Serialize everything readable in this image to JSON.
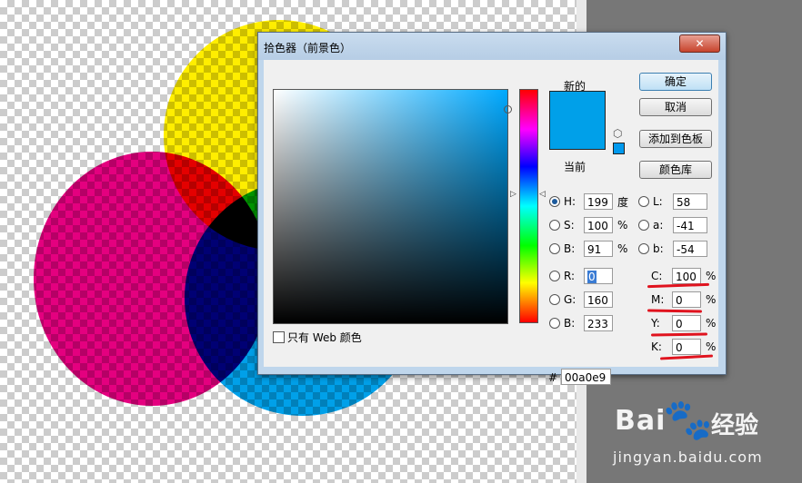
{
  "dialog": {
    "title": "拾色器（前景色）",
    "close_glyph": "✕"
  },
  "preview": {
    "new_label": "新的",
    "current_label": "当前",
    "new_color": "#00a0e9",
    "current_color": "#00a0e9"
  },
  "buttons": {
    "ok": "确定",
    "cancel": "取消",
    "add_swatch": "添加到色板",
    "color_libraries": "颜色库"
  },
  "web_only_label": "只有 Web 颜色",
  "hsb": {
    "h": {
      "label": "H:",
      "value": "199",
      "unit": "度",
      "selected": true
    },
    "s": {
      "label": "S:",
      "value": "100",
      "unit": "%"
    },
    "b": {
      "label": "B:",
      "value": "91",
      "unit": "%"
    }
  },
  "rgb": {
    "r": {
      "label": "R:",
      "value": "0"
    },
    "g": {
      "label": "G:",
      "value": "160"
    },
    "b": {
      "label": "B:",
      "value": "233"
    }
  },
  "lab": {
    "l": {
      "label": "L:",
      "value": "58"
    },
    "a": {
      "label": "a:",
      "value": "-41"
    },
    "b": {
      "label": "b:",
      "value": "-54"
    }
  },
  "cmyk": {
    "c": {
      "label": "C:",
      "value": "100",
      "unit": "%"
    },
    "m": {
      "label": "M:",
      "value": "0",
      "unit": "%"
    },
    "y": {
      "label": "Y:",
      "value": "0",
      "unit": "%"
    },
    "k": {
      "label": "K:",
      "value": "0",
      "unit": "%"
    }
  },
  "hex": {
    "label": "#",
    "value": "00a0e9"
  },
  "colors": {
    "accent": "#00a0e9",
    "annotation_red": "#e0131e",
    "yellow": "#ffee00",
    "magenta": "#e4007f"
  },
  "watermark": {
    "brand_left": "Bai",
    "brand_right": "经验",
    "url": "jingyan.baidu.com"
  }
}
